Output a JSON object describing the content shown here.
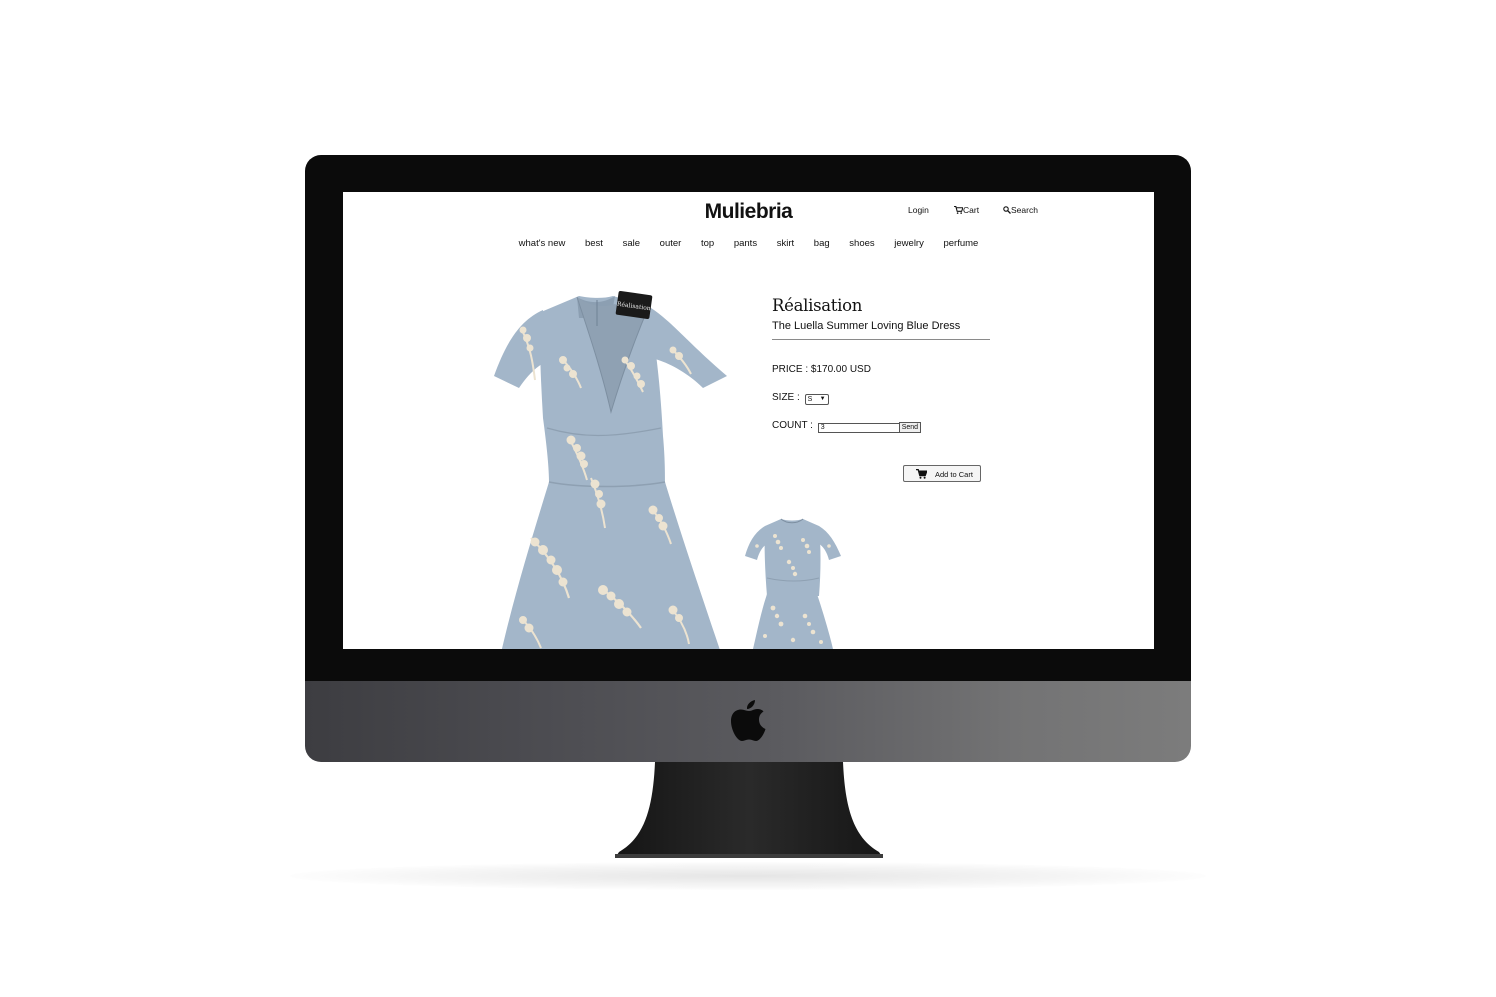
{
  "page": {
    "logo": "Muliebria",
    "header_links": {
      "login": "Login",
      "cart": "Cart",
      "search": "Search"
    },
    "nav": [
      "what's new",
      "best",
      "sale",
      "outer",
      "top",
      "pants",
      "skirt",
      "bag",
      "shoes",
      "jewelry",
      "perfume"
    ]
  },
  "product": {
    "brand": "Réalisation",
    "name": "The Luella Summer Loving Blue Dress",
    "price": "PRICE : $170.00 USD",
    "size_label": "SIZE :",
    "size_value": "S",
    "count_label": "COUNT :",
    "count_value": "3",
    "send_label": "Send",
    "add_to_cart_label": "Add to Cart",
    "dress_label": "Réalisation"
  },
  "colors": {
    "dress": "#a3b6c9",
    "flowers": "#ece3d1",
    "bezel": "#0b0b0b"
  },
  "icons": [
    "apple-logo-icon",
    "cart-icon",
    "search-icon"
  ]
}
